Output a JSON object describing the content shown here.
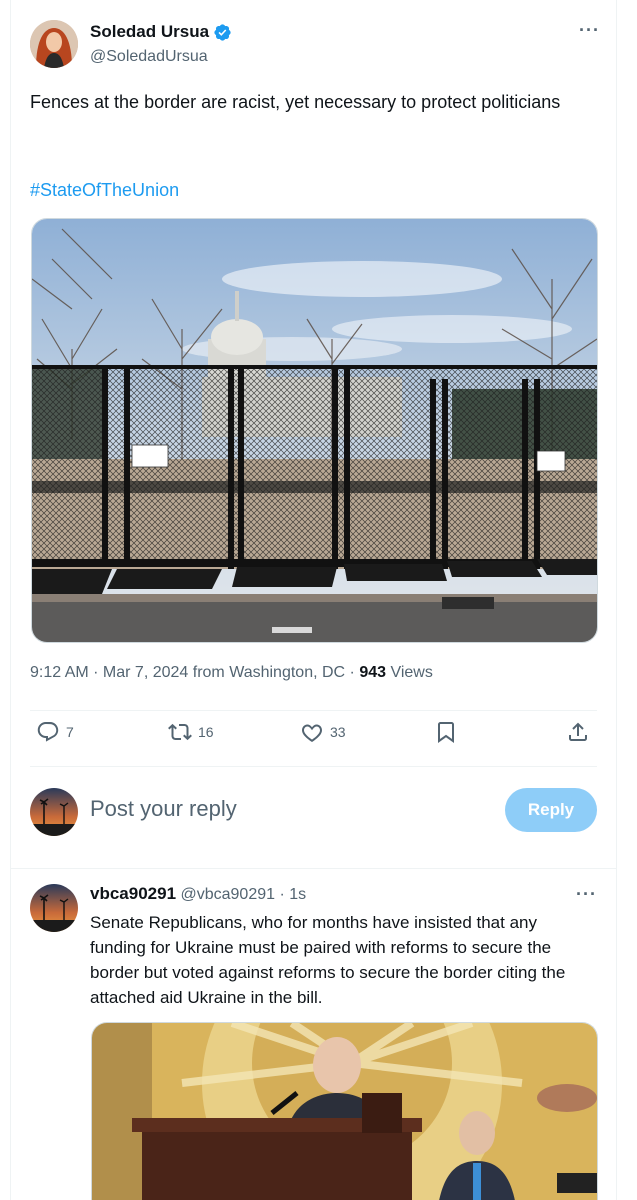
{
  "post": {
    "author_name": "Soledad Ursua",
    "author_handle": "@SoledadUrsua",
    "text": "Fences at the border are racist, yet necessary to protect politicians",
    "hashtag": "#StateOfTheUnion",
    "time": "9:12 AM · Mar 7, 2024 from Washington, DC · ",
    "views_count": "943",
    "views_label": " Views",
    "more_icon": "more-icon",
    "verified_icon": "verified-icon"
  },
  "actions": {
    "replies": "7",
    "reposts": "16",
    "likes": "33"
  },
  "reply_composer": {
    "placeholder": "Post your reply",
    "button_label": "Reply"
  },
  "reply": {
    "author_name": "vbca90291",
    "author_handle": "@vbca90291",
    "time": " · 1s",
    "text": "Senate Republicans, who for months have insisted that any funding for Ukraine must be paired with reforms to secure the border but voted against reforms to secure the border citing the attached aid Ukraine in the bill."
  },
  "colors": {
    "accent": "#1d9bf0",
    "reply_button": "#8ecdf8",
    "secondary_text": "#536471"
  }
}
